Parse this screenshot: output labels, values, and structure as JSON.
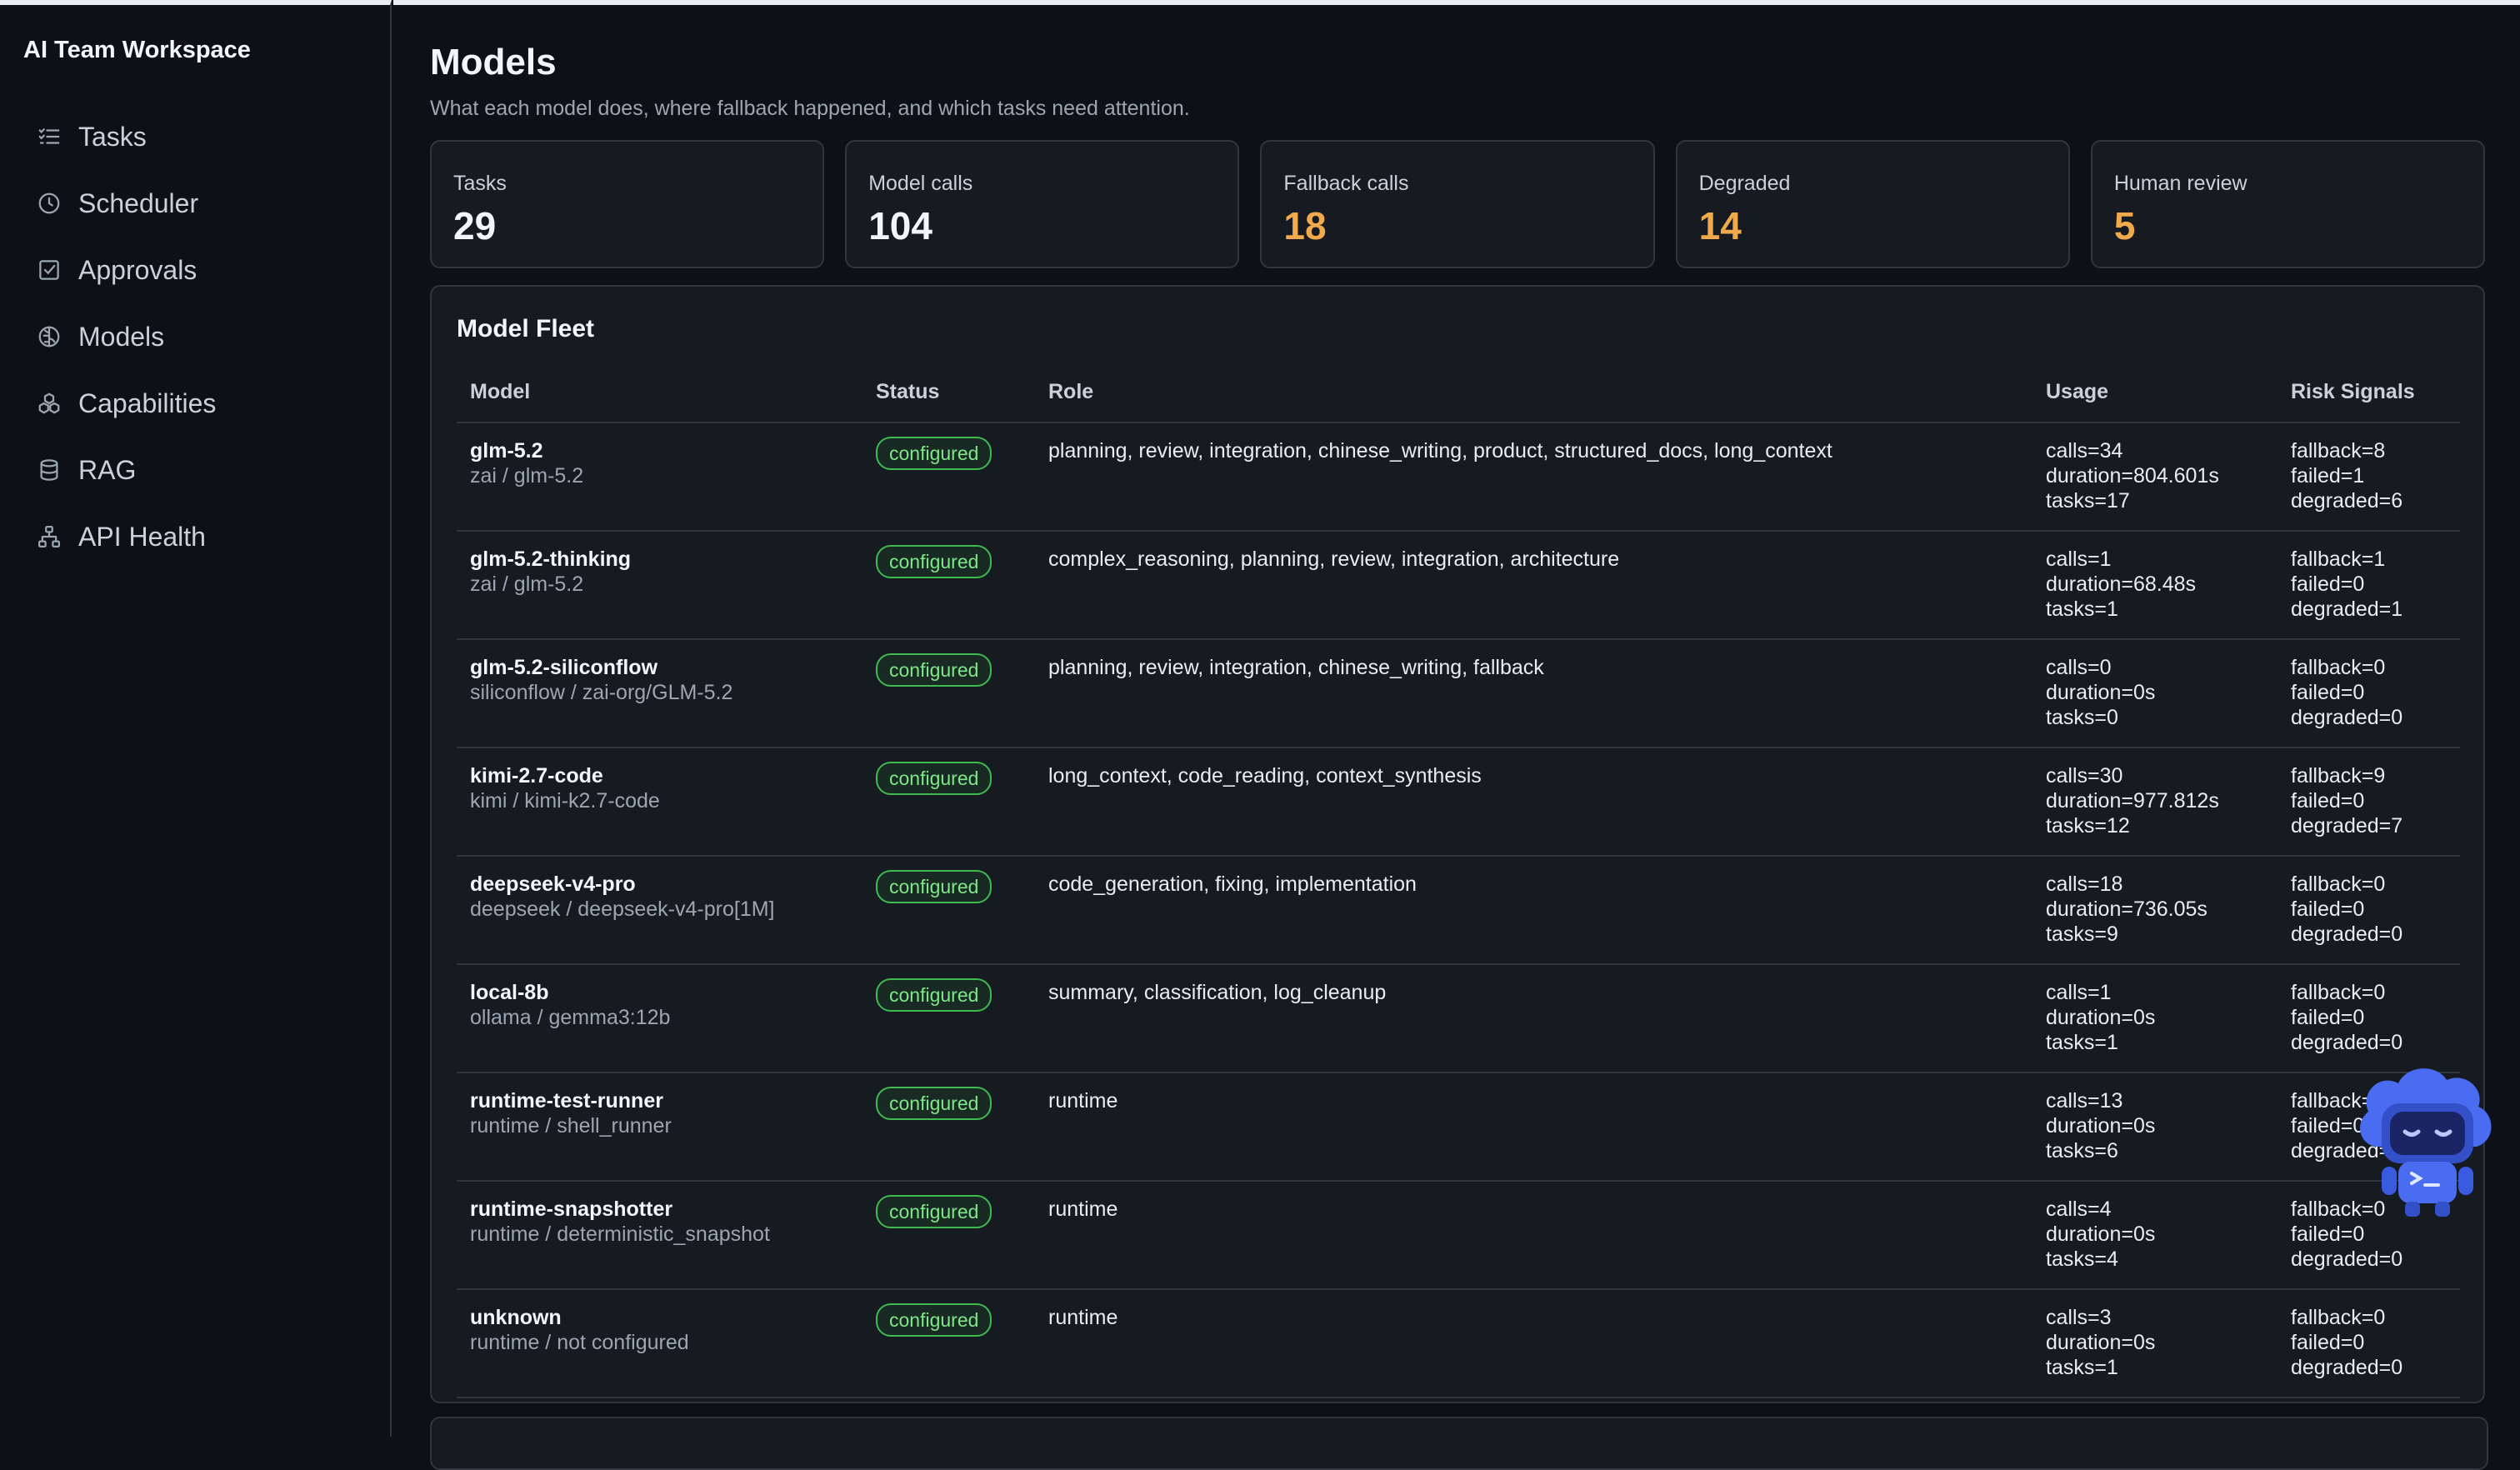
{
  "sidebar": {
    "brand": "AI Team Workspace",
    "items": [
      {
        "label": "Tasks",
        "icon": "tasks-icon"
      },
      {
        "label": "Scheduler",
        "icon": "clock-icon"
      },
      {
        "label": "Approvals",
        "icon": "checkbox-icon"
      },
      {
        "label": "Models",
        "icon": "brain-icon"
      },
      {
        "label": "Capabilities",
        "icon": "cubes-icon"
      },
      {
        "label": "RAG",
        "icon": "database-icon"
      },
      {
        "label": "API Health",
        "icon": "network-icon"
      }
    ]
  },
  "page": {
    "title": "Models",
    "subtitle": "What each model does, where fallback happened, and which tasks need attention."
  },
  "stats": [
    {
      "label": "Tasks",
      "value": "29"
    },
    {
      "label": "Model calls",
      "value": "104"
    },
    {
      "label": "Fallback calls",
      "value": "18"
    },
    {
      "label": "Degraded",
      "value": "14"
    },
    {
      "label": "Human review",
      "value": "5"
    }
  ],
  "colors": {
    "warning": "#f0a94b",
    "success": "#3fb950",
    "background": "#0d1117",
    "panel": "#161b22"
  },
  "fleet": {
    "title": "Model Fleet",
    "columns": {
      "model": "Model",
      "status": "Status",
      "role": "Role",
      "usage": "Usage",
      "risk": "Risk Signals"
    },
    "rows": [
      {
        "name": "glm-5.2",
        "provider": "zai / glm-5.2",
        "status": "configured",
        "role": "planning, review, integration, chinese_writing, product, structured_docs, long_context",
        "calls": "calls=34",
        "duration": "duration=804.601s",
        "tasks": "tasks=17",
        "fallback": "fallback=8",
        "failed": "failed=1",
        "degraded": "degraded=6"
      },
      {
        "name": "glm-5.2-thinking",
        "provider": "zai / glm-5.2",
        "status": "configured",
        "role": "complex_reasoning, planning, review, integration, architecture",
        "calls": "calls=1",
        "duration": "duration=68.48s",
        "tasks": "tasks=1",
        "fallback": "fallback=1",
        "failed": "failed=0",
        "degraded": "degraded=1"
      },
      {
        "name": "glm-5.2-siliconflow",
        "provider": "siliconflow / zai-org/GLM-5.2",
        "status": "configured",
        "role": "planning, review, integration, chinese_writing, fallback",
        "calls": "calls=0",
        "duration": "duration=0s",
        "tasks": "tasks=0",
        "fallback": "fallback=0",
        "failed": "failed=0",
        "degraded": "degraded=0"
      },
      {
        "name": "kimi-2.7-code",
        "provider": "kimi / kimi-k2.7-code",
        "status": "configured",
        "role": "long_context, code_reading, context_synthesis",
        "calls": "calls=30",
        "duration": "duration=977.812s",
        "tasks": "tasks=12",
        "fallback": "fallback=9",
        "failed": "failed=0",
        "degraded": "degraded=7"
      },
      {
        "name": "deepseek-v4-pro",
        "provider": "deepseek / deepseek-v4-pro[1M]",
        "status": "configured",
        "role": "code_generation, fixing, implementation",
        "calls": "calls=18",
        "duration": "duration=736.05s",
        "tasks": "tasks=9",
        "fallback": "fallback=0",
        "failed": "failed=0",
        "degraded": "degraded=0"
      },
      {
        "name": "local-8b",
        "provider": "ollama / gemma3:12b",
        "status": "configured",
        "role": "summary, classification, log_cleanup",
        "calls": "calls=1",
        "duration": "duration=0s",
        "tasks": "tasks=1",
        "fallback": "fallback=0",
        "failed": "failed=0",
        "degraded": "degraded=0"
      },
      {
        "name": "runtime-test-runner",
        "provider": "runtime / shell_runner",
        "status": "configured",
        "role": "runtime",
        "calls": "calls=13",
        "duration": "duration=0s",
        "tasks": "tasks=6",
        "fallback": "fallback=0",
        "failed": "failed=0",
        "degraded": "degraded=0"
      },
      {
        "name": "runtime-snapshotter",
        "provider": "runtime / deterministic_snapshot",
        "status": "configured",
        "role": "runtime",
        "calls": "calls=4",
        "duration": "duration=0s",
        "tasks": "tasks=4",
        "fallback": "fallback=0",
        "failed": "failed=0",
        "degraded": "degraded=0"
      },
      {
        "name": "unknown",
        "provider": "runtime / not configured",
        "status": "configured",
        "role": "runtime",
        "calls": "calls=3",
        "duration": "duration=0s",
        "tasks": "tasks=1",
        "fallback": "fallback=0",
        "failed": "failed=0",
        "degraded": "degraded=0"
      }
    ]
  },
  "mascot": {
    "icon": "robot-assistant-icon"
  }
}
